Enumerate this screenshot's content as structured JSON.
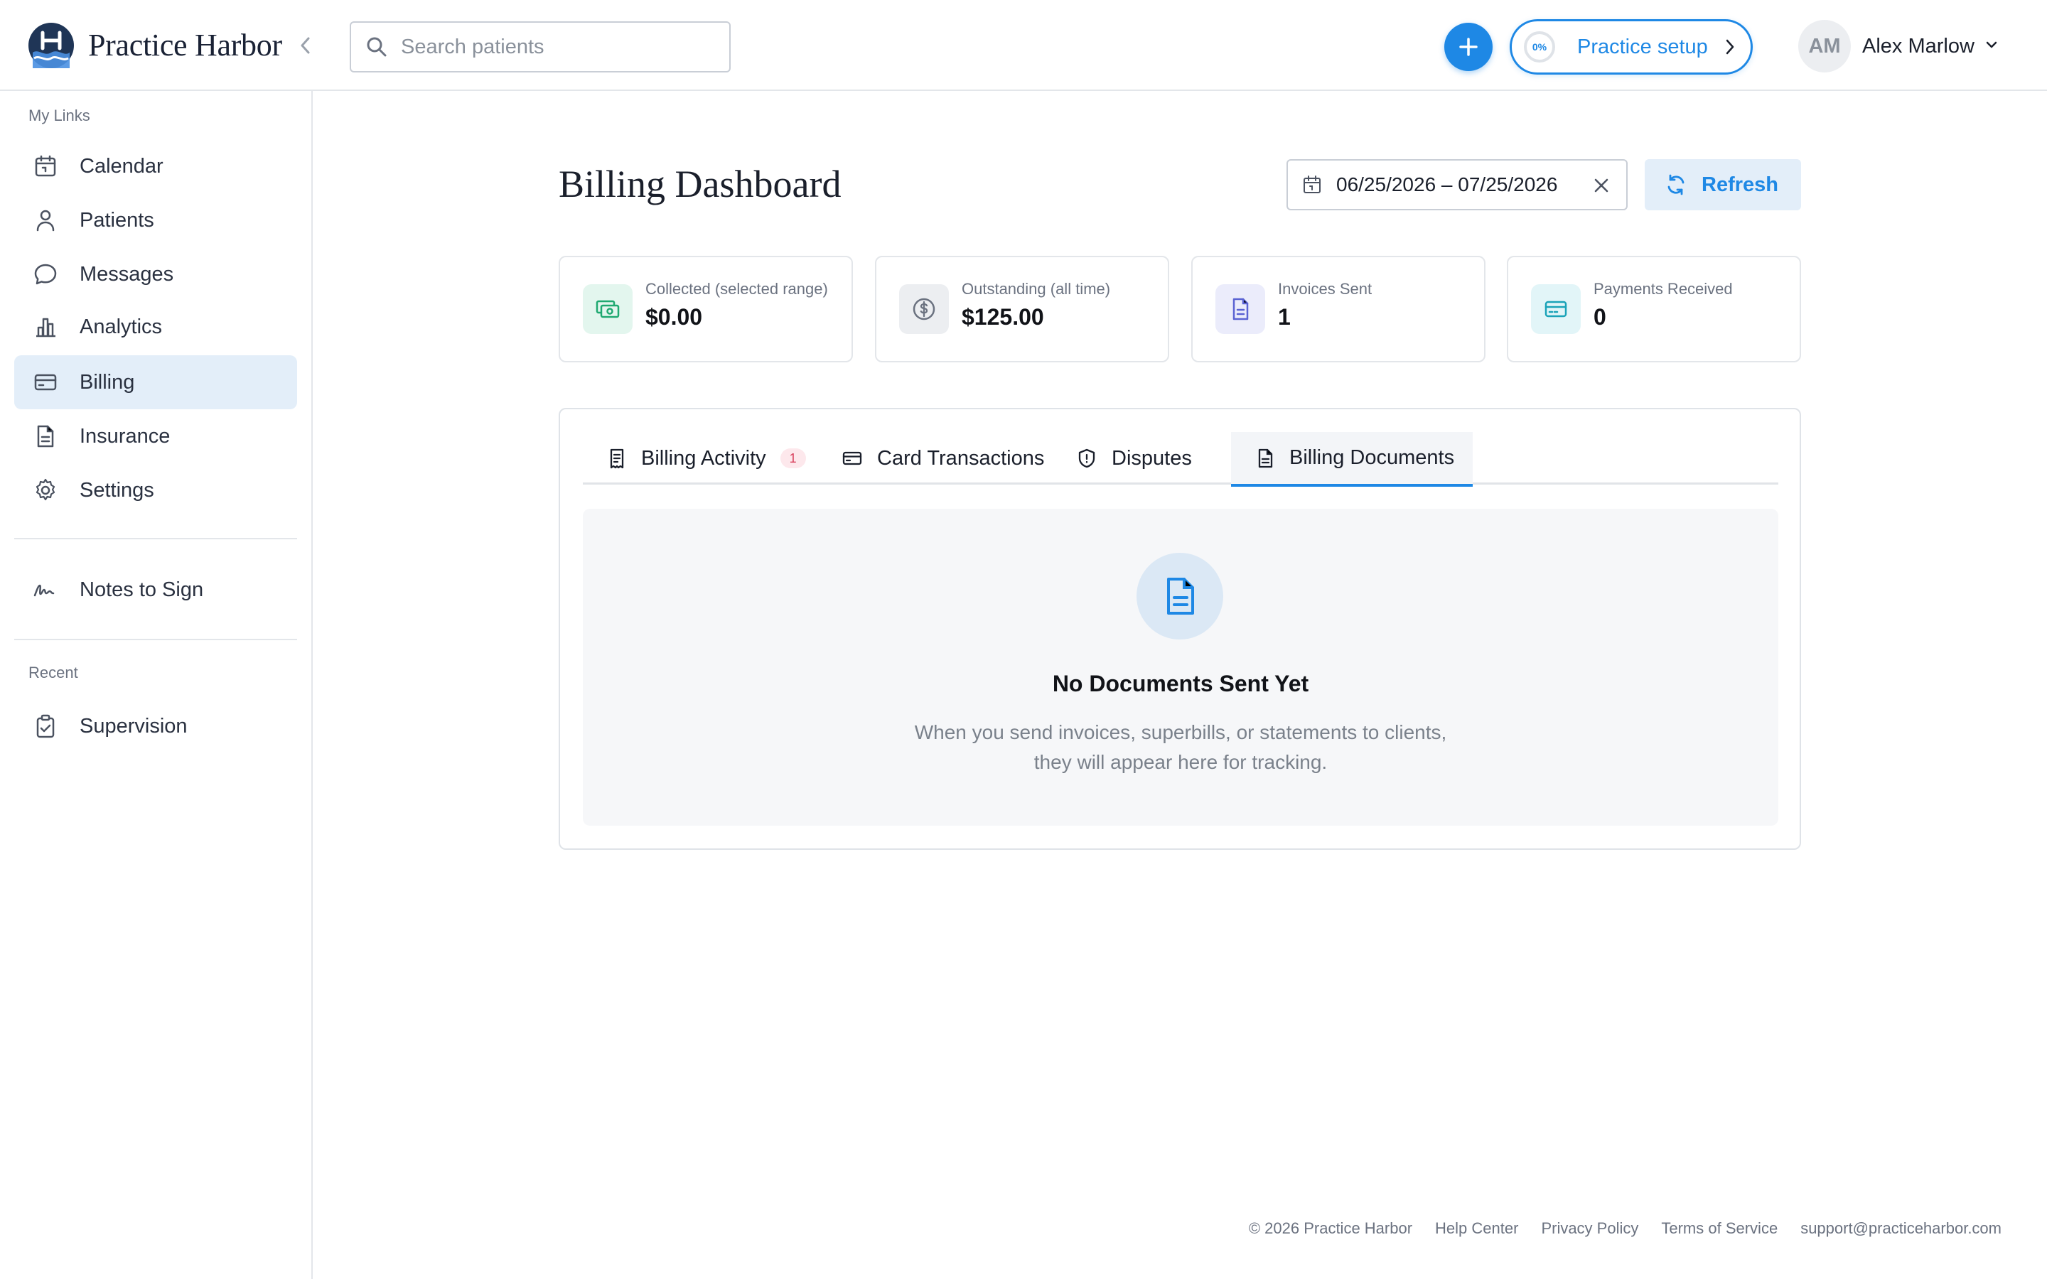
{
  "app": {
    "brand_name": "Practice Harbor",
    "accent_color": "#1e88e5"
  },
  "header": {
    "search_placeholder": "Search patients",
    "setup": {
      "progress_label": "0%",
      "progress_value": 0,
      "label": "Practice setup"
    },
    "user": {
      "initials": "AM",
      "name": "Alex Marlow"
    },
    "icons": [
      "logo-icon",
      "chevron-left-icon",
      "search-icon",
      "plus-icon",
      "chevron-right-icon",
      "chevron-down-icon"
    ]
  },
  "sidebar": {
    "my_links_label": "My Links",
    "items": [
      {
        "label": "Calendar",
        "icon": "calendar-icon"
      },
      {
        "label": "Patients",
        "icon": "person-icon"
      },
      {
        "label": "Messages",
        "icon": "message-icon"
      },
      {
        "label": "Analytics",
        "icon": "bar-chart-icon"
      },
      {
        "label": "Billing",
        "icon": "credit-card-icon",
        "active": true
      },
      {
        "label": "Insurance",
        "icon": "document-icon"
      },
      {
        "label": "Settings",
        "icon": "gear-icon"
      }
    ],
    "notes": {
      "label": "Notes to Sign",
      "icon": "signature-icon"
    },
    "recent_label": "Recent",
    "recent": [
      {
        "label": "Supervision",
        "icon": "clipboard-check-icon"
      }
    ]
  },
  "main": {
    "title": "Billing Dashboard",
    "date_range": "06/25/2026 – 07/25/2026",
    "refresh_label": "Refresh",
    "stats": [
      {
        "label": "Collected (selected range)",
        "value": "$0.00",
        "icon": "cash-icon",
        "color": "#1fa971",
        "bg": "#e3f6ee"
      },
      {
        "label": "Outstanding (all time)",
        "value": "$125.00",
        "icon": "dollar-circle-icon",
        "color": "#6b7280",
        "bg": "#eceef1"
      },
      {
        "label": "Invoices Sent",
        "value": "1",
        "icon": "invoice-icon",
        "color": "#5b63d3",
        "bg": "#ebecfb"
      },
      {
        "label": "Payments Received",
        "value": "0",
        "icon": "credit-card-icon",
        "color": "#1aa3b8",
        "bg": "#e2f5f8"
      }
    ],
    "tabs": [
      {
        "label": "Billing Activity",
        "badge": "1",
        "icon": "receipt-icon"
      },
      {
        "label": "Card Transactions",
        "icon": "credit-card-icon"
      },
      {
        "label": "Disputes",
        "icon": "shield-alert-icon"
      },
      {
        "label": "Billing Documents",
        "icon": "document-icon",
        "active": true
      }
    ],
    "empty_state": {
      "title": "No Documents Sent Yet",
      "description": "When you send invoices, superbills, or statements to clients, they will appear here for tracking."
    }
  },
  "footer": {
    "copyright": "© 2026 Practice Harbor",
    "links": [
      "Help Center",
      "Privacy Policy",
      "Terms of Service"
    ],
    "email": "support@practiceharbor.com"
  }
}
